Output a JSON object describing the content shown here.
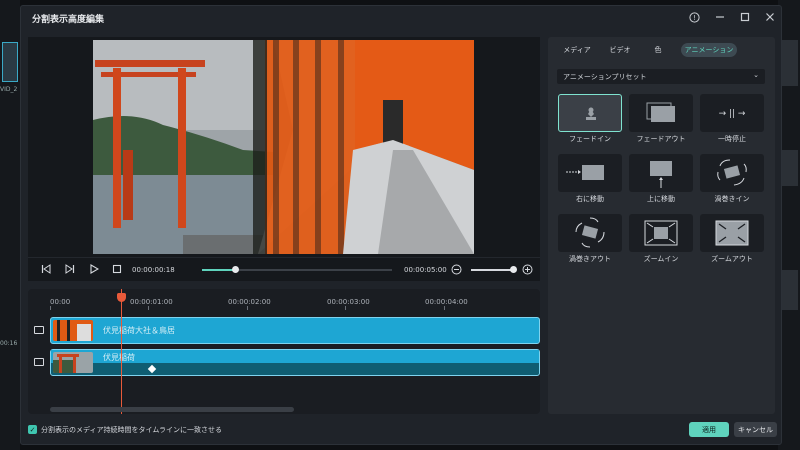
{
  "background": {
    "left_clip_label": "VID_2",
    "left_timecodes": [
      "00:16"
    ]
  },
  "dialog": {
    "title": "分割表示高度編集",
    "help_icon": "question-circle-icon",
    "minimize_icon": "minimize-icon",
    "maximize_icon": "maximize-icon",
    "close_icon": "close-icon"
  },
  "player": {
    "current_time": "00:00:00:18",
    "total_time": "00:00:05:00",
    "progress": 0.17,
    "zoom_level": 1.0,
    "icons": [
      "prev-frame-icon",
      "next-frame-icon",
      "play-icon",
      "stop-icon",
      "zoom-out-icon",
      "zoom-in-icon"
    ]
  },
  "timeline": {
    "ruler_labels": [
      "00:00",
      "00:00:01:00",
      "00:00:02:00",
      "00:00:03:00",
      "00:00:04:00"
    ],
    "tracks": [
      {
        "label": "伏見稲荷大社＆鳥居"
      },
      {
        "label": "伏見稲荷"
      }
    ]
  },
  "right_panel": {
    "tabs": [
      {
        "label": "メディア",
        "active": false
      },
      {
        "label": "ビデオ",
        "active": false
      },
      {
        "label": "色",
        "active": false
      },
      {
        "label": "アニメーション",
        "active": true
      }
    ],
    "preset_label": "アニメーションプリセット",
    "animations": [
      {
        "label": "フェードイン",
        "selected": true
      },
      {
        "label": "フェードアウト",
        "selected": false
      },
      {
        "label": "一時停止",
        "selected": false
      },
      {
        "label": "右に移動",
        "selected": false
      },
      {
        "label": "上に移動",
        "selected": false
      },
      {
        "label": "渦巻きイン",
        "selected": false
      },
      {
        "label": "渦巻きアウト",
        "selected": false
      },
      {
        "label": "ズームイン",
        "selected": false
      },
      {
        "label": "ズームアウト",
        "selected": false
      }
    ]
  },
  "footer": {
    "checkbox_label": "分割表示のメディア持続時間をタイムラインに一致させる",
    "checked": true,
    "apply_label": "適用",
    "cancel_label": "キャンセル"
  },
  "colors": {
    "accent": "#5fd3bd",
    "clip": "#1ea6d3",
    "playhead": "#e85a3a"
  }
}
